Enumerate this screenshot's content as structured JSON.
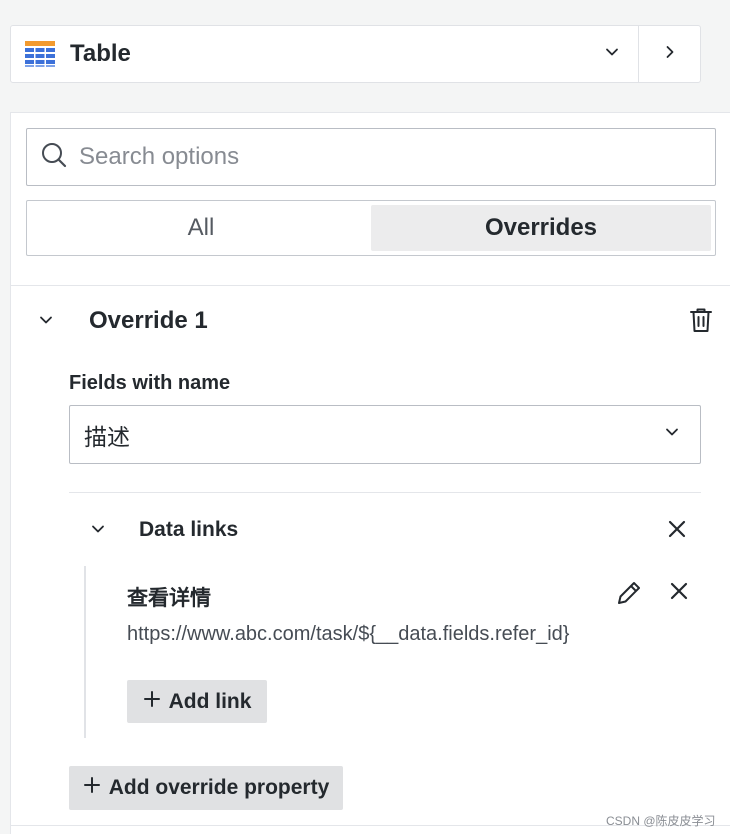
{
  "viz_picker": {
    "title": "Table",
    "icon": "table-grid-icon",
    "dropdown_icon": "chevron-down-icon",
    "next_icon": "chevron-right-icon"
  },
  "search": {
    "placeholder": "Search options",
    "value": "",
    "icon": "search-icon"
  },
  "tabs": [
    {
      "label": "All",
      "active": false
    },
    {
      "label": "Overrides",
      "active": true
    }
  ],
  "override": {
    "title": "Override 1",
    "collapse_icon": "chevron-down-icon",
    "delete_icon": "trash-icon",
    "matcher_label": "Fields with name",
    "matcher_value": "描述",
    "property": {
      "title": "Data links",
      "links": [
        {
          "title": "查看详情",
          "url": "https://www.abc.com/task/${__data.fields.refer_id}"
        }
      ],
      "add_link_label": "Add link"
    },
    "add_property_label": "Add override property"
  },
  "watermark": "CSDN @陈皮皮学习",
  "colors": {
    "background": "#f4f5f5",
    "panel": "#ffffff",
    "border": "#b9bdc4",
    "active_tab": "#ececed",
    "button": "#e0e1e3",
    "text": "#24292e"
  }
}
